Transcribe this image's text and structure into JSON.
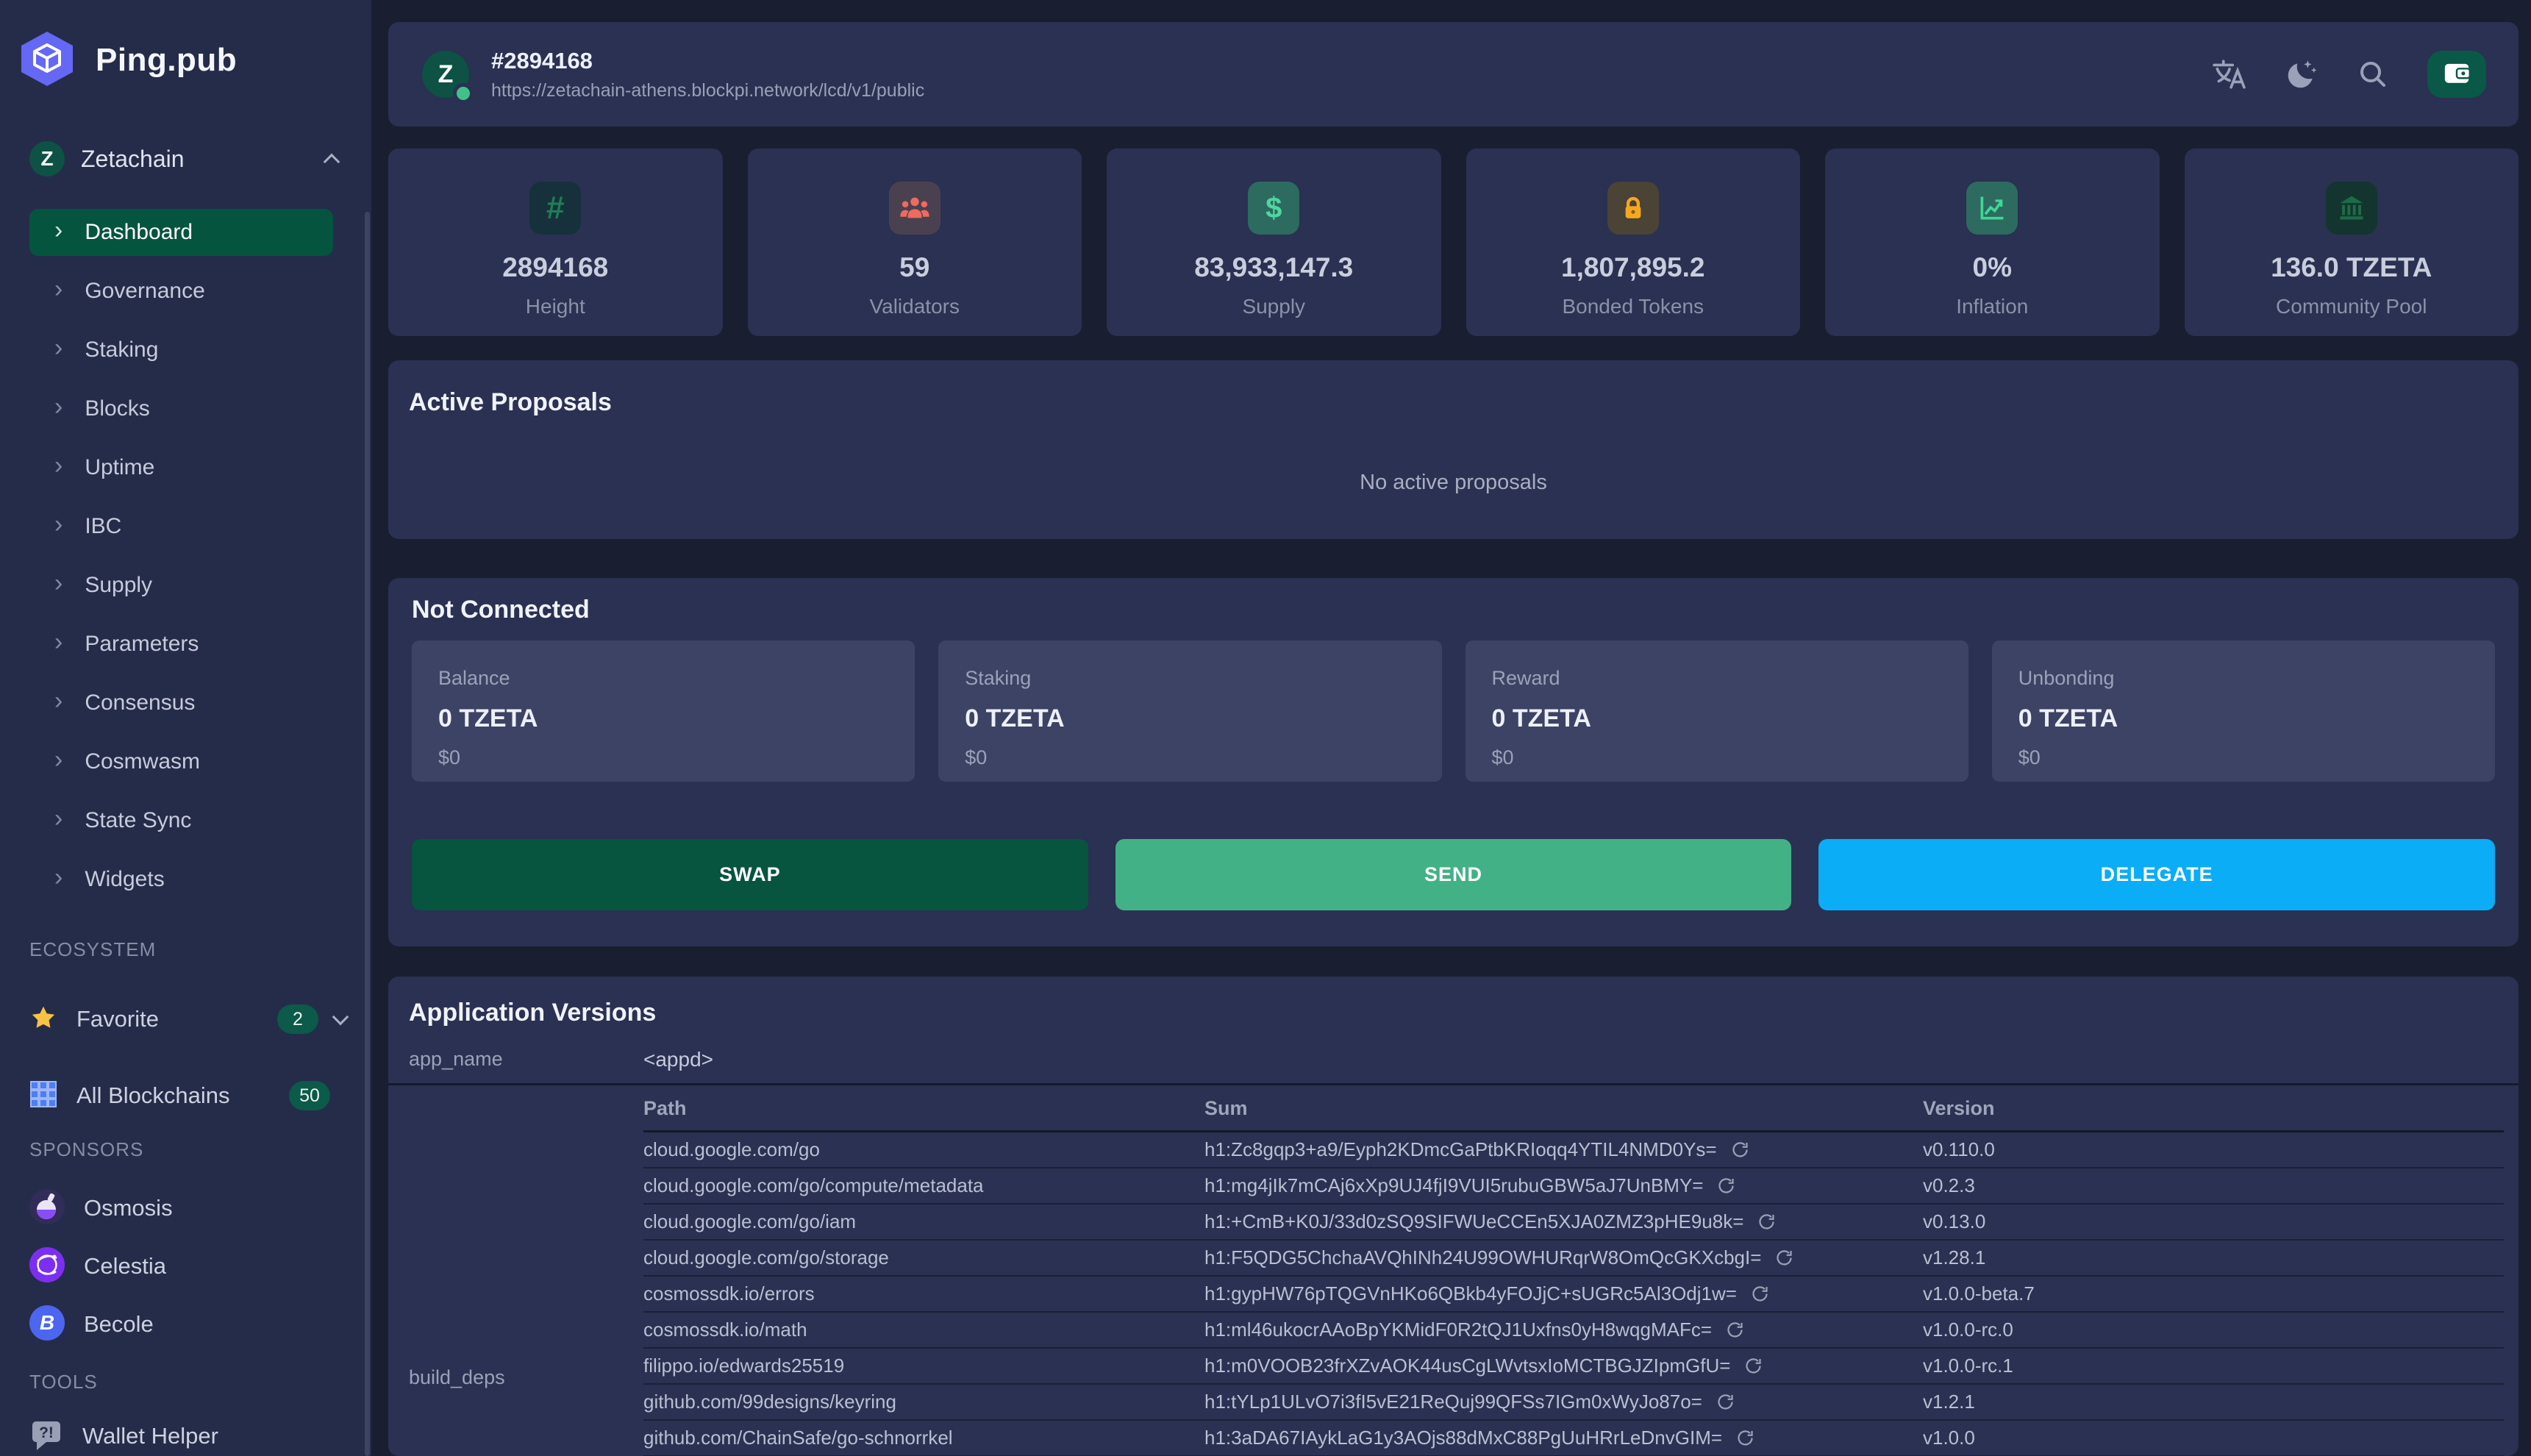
{
  "brand": {
    "name": "Ping.pub"
  },
  "sidebar": {
    "chain": {
      "name": "Zetachain"
    },
    "menu": [
      {
        "label": "Dashboard",
        "active": true
      },
      {
        "label": "Governance",
        "active": false
      },
      {
        "label": "Staking",
        "active": false
      },
      {
        "label": "Blocks",
        "active": false
      },
      {
        "label": "Uptime",
        "active": false
      },
      {
        "label": "IBC",
        "active": false
      },
      {
        "label": "Supply",
        "active": false
      },
      {
        "label": "Parameters",
        "active": false
      },
      {
        "label": "Consensus",
        "active": false
      },
      {
        "label": "Cosmwasm",
        "active": false
      },
      {
        "label": "State Sync",
        "active": false
      },
      {
        "label": "Widgets",
        "active": false
      }
    ],
    "ecosystem_label": "ECOSYSTEM",
    "favorite": {
      "label": "Favorite",
      "badge": "2"
    },
    "all_blockchains": {
      "label": "All Blockchains",
      "badge": "50"
    },
    "sponsors_label": "SPONSORS",
    "sponsors": [
      {
        "name": "Osmosis",
        "icon": "osmosis-icon"
      },
      {
        "name": "Celestia",
        "icon": "celestia-icon"
      },
      {
        "name": "Becole",
        "icon": "becole-icon"
      }
    ],
    "tools_label": "TOOLS",
    "tools": [
      {
        "name": "Wallet Helper",
        "icon": "chat-help-icon"
      }
    ]
  },
  "header": {
    "block_height": "#2894168",
    "endpoint": "https://zetachain-athens.blockpi.network/lcd/v1/public"
  },
  "stats": [
    {
      "icon": "hash-icon",
      "value": "2894168",
      "label": "Height",
      "icon_color": "#1f7e55",
      "icon_bg": "#17313c"
    },
    {
      "icon": "validators-icon",
      "value": "59",
      "label": "Validators",
      "icon_color": "#ef6a5f",
      "icon_bg": "#4a4150"
    },
    {
      "icon": "dollar-icon",
      "value": "83,933,147.3",
      "label": "Supply",
      "icon_color": "#4fd6a0",
      "icon_bg": "#2d6a60"
    },
    {
      "icon": "lock-icon",
      "value": "1,807,895.2",
      "label": "Bonded Tokens",
      "icon_color": "#f5a81f",
      "icon_bg": "#4a4336"
    },
    {
      "icon": "chart-icon",
      "value": "0%",
      "label": "Inflation",
      "icon_color": "#3fd795",
      "icon_bg": "#2d6a60"
    },
    {
      "icon": "bank-icon",
      "value": "136.0 TZETA",
      "label": "Community Pool",
      "icon_color": "#1e6b47",
      "icon_bg": "#14352f"
    }
  ],
  "proposals": {
    "title": "Active Proposals",
    "empty_message": "No active proposals"
  },
  "wallet": {
    "title": "Not Connected",
    "boxes": [
      {
        "label": "Balance",
        "amount": "0 TZETA",
        "usd": "$0"
      },
      {
        "label": "Staking",
        "amount": "0 TZETA",
        "usd": "$0"
      },
      {
        "label": "Reward",
        "amount": "0 TZETA",
        "usd": "$0"
      },
      {
        "label": "Unbonding",
        "amount": "0 TZETA",
        "usd": "$0"
      }
    ],
    "actions": [
      {
        "label": "SWAP",
        "color": "#07543f"
      },
      {
        "label": "SEND",
        "color": "#42b286"
      },
      {
        "label": "DELEGATE",
        "color": "#0badf7"
      }
    ]
  },
  "app_versions": {
    "title": "Application Versions",
    "app_name_label": "app_name",
    "app_name_value": "<appd>",
    "deps_label": "build_deps",
    "columns": [
      "Path",
      "Sum",
      "Version"
    ],
    "rows": [
      {
        "path": "cloud.google.com/go",
        "sum": "h1:Zc8gqp3+a9/Eyph2KDmcGaPtbKRIoqq4YTIL4NMD0Ys=",
        "version": "v0.110.0"
      },
      {
        "path": "cloud.google.com/go/compute/metadata",
        "sum": "h1:mg4jIk7mCAj6xXp9UJ4fjI9VUI5rubuGBW5aJ7UnBMY=",
        "version": "v0.2.3"
      },
      {
        "path": "cloud.google.com/go/iam",
        "sum": "h1:+CmB+K0J/33d0zSQ9SIFWUeCCEn5XJA0ZMZ3pHE9u8k=",
        "version": "v0.13.0"
      },
      {
        "path": "cloud.google.com/go/storage",
        "sum": "h1:F5QDG5ChchaAVQhINh24U99OWHURqrW8OmQcGKXcbgI=",
        "version": "v1.28.1"
      },
      {
        "path": "cosmossdk.io/errors",
        "sum": "h1:gypHW76pTQGVnHKo6QBkb4yFOJjC+sUGRc5Al3Odj1w=",
        "version": "v1.0.0-beta.7"
      },
      {
        "path": "cosmossdk.io/math",
        "sum": "h1:ml46ukocrAAoBpYKMidF0R2tQJ1Uxfns0yH8wqgMAFc=",
        "version": "v1.0.0-rc.0"
      },
      {
        "path": "filippo.io/edwards25519",
        "sum": "h1:m0VOOB23frXZvAOK44usCgLWvtsxIoMCTBGJZIpmGfU=",
        "version": "v1.0.0-rc.1"
      },
      {
        "path": "github.com/99designs/keyring",
        "sum": "h1:tYLp1ULvO7i3fI5vE21ReQuj99QFSs7IGm0xWyJo87o=",
        "version": "v1.2.1"
      },
      {
        "path": "github.com/ChainSafe/go-schnorrkel",
        "sum": "h1:3aDA67IAykLaG1y3AOjs88dMxC88PgUuHRrLeDnvGIM=",
        "version": "v1.0.0"
      }
    ]
  }
}
